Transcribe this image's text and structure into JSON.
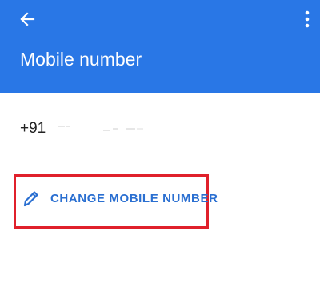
{
  "app_bar": {
    "title": "Mobile number",
    "background_color": "#2977e6",
    "back_icon": "arrow-back-icon",
    "menu_icon": "more-vert-icon"
  },
  "number": {
    "country_code": "+91",
    "masked_digits": "·· ·· ···· ····"
  },
  "action": {
    "label": "CHANGE MOBILE NUMBER",
    "icon": "pencil-icon",
    "color": "#2a6fd1",
    "highlight_color": "#e0202b"
  }
}
